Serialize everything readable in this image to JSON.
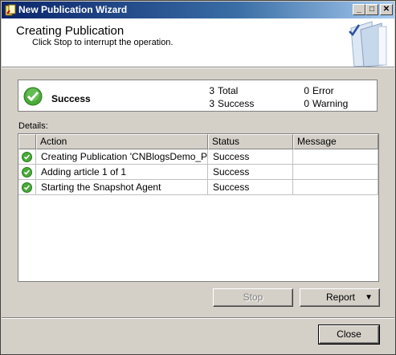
{
  "window": {
    "title": "New Publication Wizard"
  },
  "header": {
    "title": "Creating Publication",
    "subtitle": "Click Stop to interrupt the operation."
  },
  "summary": {
    "status": "Success",
    "total_count": "3",
    "total_label": "Total",
    "success_count": "3",
    "success_label": "Success",
    "error_count": "0",
    "error_label": "Error",
    "warning_count": "0",
    "warning_label": "Warning"
  },
  "details": {
    "label": "Details:",
    "columns": [
      "Action",
      "Status",
      "Message"
    ],
    "rows": [
      {
        "action": "Creating Publication 'CNBlogsDemo_Pu...",
        "status": "Success",
        "message": ""
      },
      {
        "action": "Adding article 1 of 1",
        "status": "Success",
        "message": ""
      },
      {
        "action": "Starting the Snapshot Agent",
        "status": "Success",
        "message": ""
      }
    ]
  },
  "buttons": {
    "stop": "Stop",
    "report": "Report",
    "close": "Close"
  },
  "colors": {
    "success": "#3a9a2a",
    "titlebar": "#0a246a"
  }
}
